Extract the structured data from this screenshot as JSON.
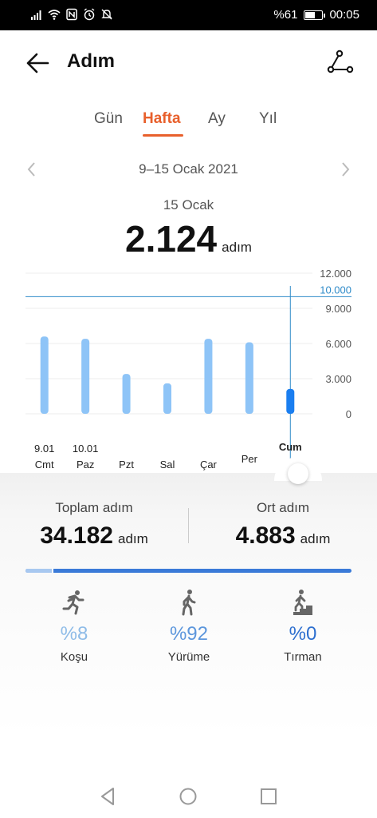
{
  "status": {
    "battery_pct": "%61",
    "time": "00:05",
    "battery_level": 0.61
  },
  "header": {
    "title": "Adım"
  },
  "tabs": [
    {
      "label": "Gün",
      "active": false
    },
    {
      "label": "Hafta",
      "active": true
    },
    {
      "label": "Ay",
      "active": false
    },
    {
      "label": "Yıl",
      "active": false
    }
  ],
  "range": {
    "label": "9–15 Ocak 2021"
  },
  "selected": {
    "date": "15 Ocak",
    "value": "2.124",
    "unit": "adım"
  },
  "chart_data": {
    "type": "bar",
    "categories": [
      "Cmt",
      "Paz",
      "Pzt",
      "Sal",
      "Çar",
      "Per",
      "Cum"
    ],
    "date_labels": [
      "9.01",
      "10.01",
      "",
      "",
      "",
      "",
      ""
    ],
    "values": [
      6600,
      6400,
      3400,
      2600,
      6400,
      6100,
      2124
    ],
    "y_ticks": [
      "12.000",
      "9.000",
      "6.000",
      "3.000",
      "0"
    ],
    "ylim": [
      0,
      12000
    ],
    "goal": {
      "value": 10000,
      "label": "10.000"
    },
    "selected_index": 6,
    "colors": {
      "bar": "#8ec4f7",
      "selected": "#1a7ef0",
      "goal": "#2f8bc9"
    }
  },
  "summary": {
    "total": {
      "label": "Toplam adım",
      "value": "34.182",
      "unit": "adım"
    },
    "average": {
      "label": "Ort adım",
      "value": "4.883",
      "unit": "adım"
    }
  },
  "activity": [
    {
      "name": "Koşu",
      "pct": "%8",
      "fraction": 0.08,
      "icon": "running-icon",
      "color": "#8fbce8"
    },
    {
      "name": "Yürüme",
      "pct": "%92",
      "fraction": 0.92,
      "icon": "walking-icon",
      "color": "#5c96dc"
    },
    {
      "name": "Tırman",
      "pct": "%0",
      "fraction": 0.0,
      "icon": "climbing-icon",
      "color": "#2d6fcf"
    }
  ],
  "colors": {
    "accent": "#e8602c",
    "progress_light": "#a8c8f0",
    "progress_dark": "#3a7ad8"
  }
}
